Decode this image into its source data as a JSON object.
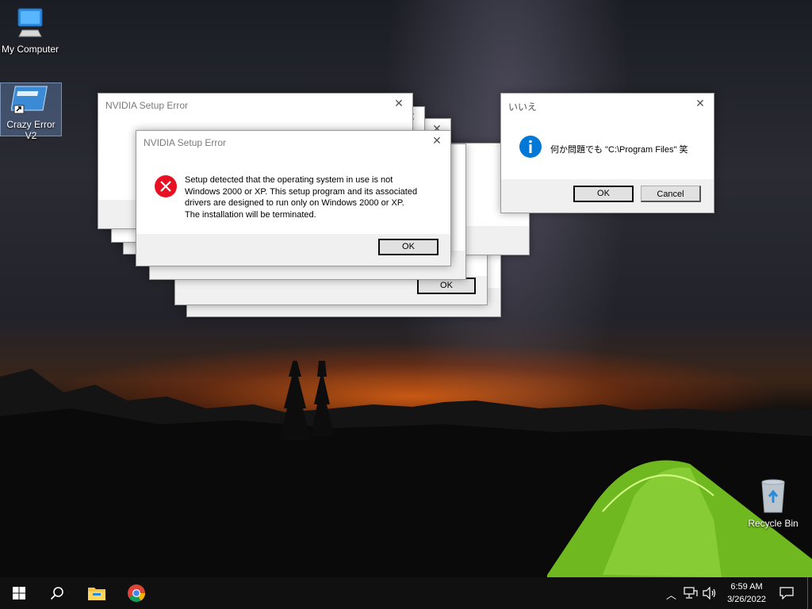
{
  "desktop": {
    "icons": [
      {
        "name": "my-computer",
        "label": "My Computer"
      },
      {
        "name": "crazy-error",
        "label": "Crazy Error V2"
      },
      {
        "name": "recycle-bin",
        "label": "Recycle Bin"
      }
    ]
  },
  "nvidia_dialog": {
    "title": "NVIDIA Setup Error",
    "message_lines": [
      "Setup detected that the operating system in use is not",
      "Windows 2000 or XP. This setup program and its associated",
      "drivers are designed to run only on Windows 2000 or XP.",
      "The installation will be terminated."
    ],
    "ok_label": "OK",
    "icon": "error-x-icon"
  },
  "back_dialog": {
    "title": "NVIDIA Setup Error",
    "ok_label": "OK"
  },
  "jp_dialog": {
    "title": "いいえ",
    "message": "何か問題でも \"C:\\Program Files\" 笑",
    "ok_label": "OK",
    "cancel_label": "Cancel",
    "icon": "info-icon"
  },
  "taskbar": {
    "start": "windows-start-icon",
    "search": "search-icon",
    "explorer": "file-explorer-icon",
    "browser": "chrome-icon",
    "time": "6:59 AM",
    "date": "3/26/2022"
  },
  "colors": {
    "error_red": "#e81123",
    "info_blue": "#0078d7",
    "taskbar": "#101010"
  }
}
